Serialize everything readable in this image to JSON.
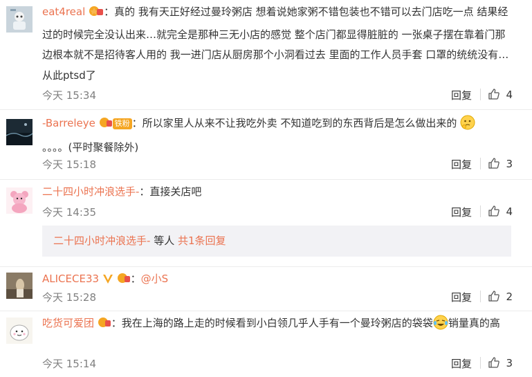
{
  "comments": [
    {
      "user": "eat4real",
      "text": "：真的 我有天正好经过曼玲粥店 想着说她家粥不错包装也不错可以去门店吃一点 结果经过的时候完全没认出来…就完全是那种三无小店的感觉 整个店门都显得脏脏的 一张桌子摆在靠着门那边根本就不是招待客人用的 我一进门店从厨房那个小洞看过去 里面的工作人员手套 口罩的统统没有…从此ptsd了",
      "time": "今天 15:34",
      "reply": "回复",
      "likes": "4"
    },
    {
      "user": "-Barreleye",
      "badge_text": "铁粉",
      "text": "：所以家里人从来不让我吃外卖 不知道吃到的东西背后是怎么做出来的",
      "text2": "。。。。(平时聚餐除外)",
      "time": "今天 15:18",
      "reply": "回复",
      "likes": "3"
    },
    {
      "user": "二十四小时冲浪选手-",
      "text": "：直接关店吧",
      "time": "今天 14:35",
      "reply": "回复",
      "likes": "4",
      "subreply": {
        "user": "二十四小时冲浪选手-",
        "text": " 等人 ",
        "count": "共1条回复"
      }
    },
    {
      "user": "ALICECE33",
      "text": "：",
      "mention": "@小S",
      "time": "今天 15:28",
      "reply": "回复",
      "likes": "2"
    },
    {
      "user": "吃货可爱团",
      "text": "：我在上海的路上走的时候看到小白领几乎人手有一个曼玲粥店的袋袋",
      "text_after": "销量真的高",
      "time": "今天 15:14",
      "reply": "回复",
      "likes": "3"
    }
  ],
  "colors": {
    "accent": "#eb7350",
    "muted": "#808080",
    "subreply_bg": "#f2f2f5"
  }
}
